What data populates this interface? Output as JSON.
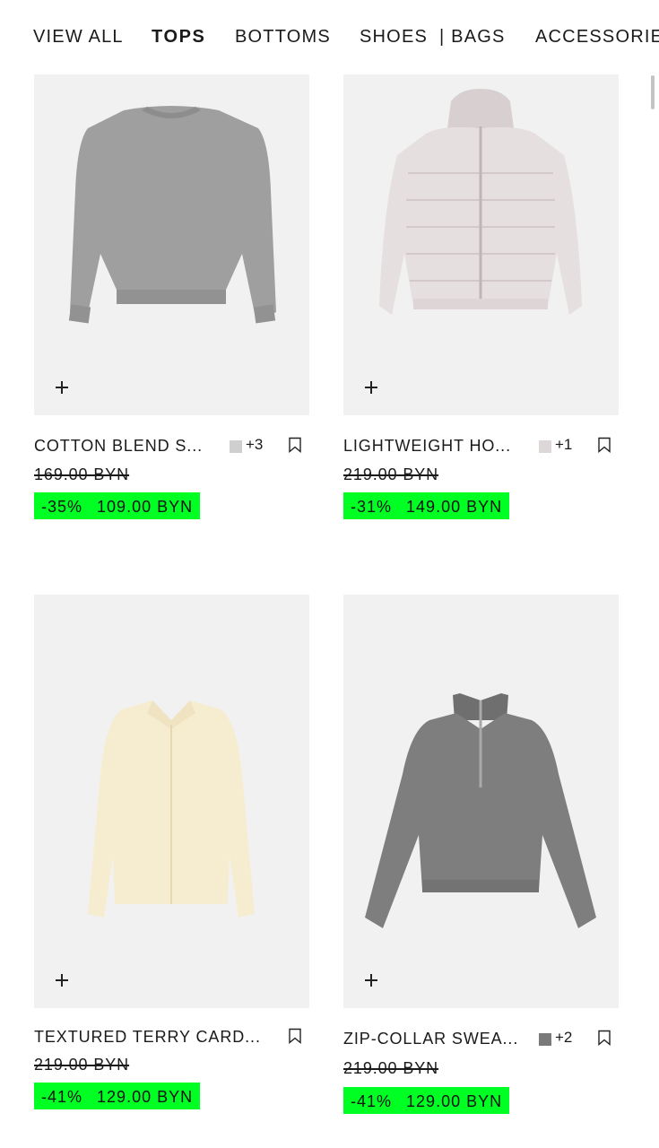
{
  "nav": {
    "items": [
      "VIEW ALL",
      "TOPS",
      "BOTTOMS",
      "SHOES",
      "| BAGS",
      "ACCESSORIES"
    ],
    "active": "TOPS"
  },
  "products": [
    {
      "name": "COTTON BLEND S...",
      "swatch_color": "#cfcfcf",
      "more_colors": "+3",
      "old_price": "169.00 BYN",
      "discount": "-35%",
      "price": "109.00 BYN",
      "garment": "grey-sweater"
    },
    {
      "name": "LIGHTWEIGHT HO...",
      "swatch_color": "#ddd7d8",
      "more_colors": "+1",
      "old_price": "219.00 BYN",
      "discount": "-31%",
      "price": "149.00 BYN",
      "garment": "light-puffer-jacket"
    },
    {
      "name": "TEXTURED TERRY CARD...",
      "old_price": "219.00 BYN",
      "discount": "-41%",
      "price": "129.00 BYN",
      "garment": "cream-cardigan"
    },
    {
      "name": "ZIP-COLLAR SWEA...",
      "swatch_color": "#7a7a7a",
      "more_colors": "+2",
      "old_price": "219.00 BYN",
      "discount": "-41%",
      "price": "129.00 BYN",
      "garment": "grey-zip-sweater"
    }
  ],
  "colors": {
    "sale_badge": "#00ff22",
    "image_bg": "#f1f1f1"
  }
}
